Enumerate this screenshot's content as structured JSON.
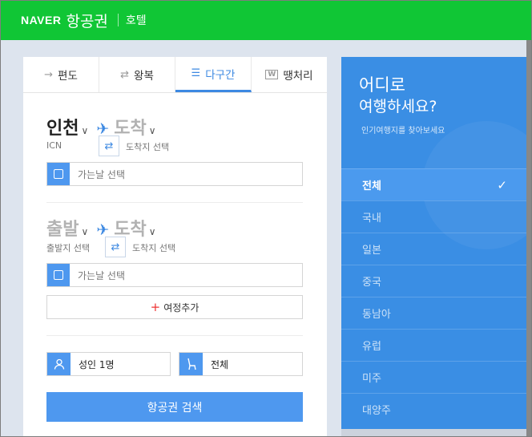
{
  "header": {
    "brand": "NAVER",
    "brand_sub": "항공권",
    "nav_hotel": "호텔"
  },
  "tabs": [
    {
      "label": "편도",
      "icon": "→"
    },
    {
      "label": "왕복",
      "icon": "⇄"
    },
    {
      "label": "다구간",
      "icon": "☰",
      "active": true
    },
    {
      "label": "땡처리",
      "icon": "W"
    }
  ],
  "segment1": {
    "origin": "인천",
    "origin_code": "ICN",
    "dest": "도착",
    "dest_hint": "도착지 선택",
    "date_placeholder": "가는날 선택"
  },
  "segment2": {
    "origin": "출발",
    "origin_hint": "출발지 선택",
    "dest": "도착",
    "dest_hint": "도착지 선택",
    "date_placeholder": "가는날 선택"
  },
  "add_trip": {
    "plus": "+",
    "label": "여정추가"
  },
  "passengers": "성인 1명",
  "seat_class": "전체",
  "search_button": "항공권 검색",
  "sidebar": {
    "title_line1": "어디로",
    "title_line2": "여행하세요?",
    "hint": "인기여행지를 찾아보세요",
    "regions": [
      "전체",
      "국내",
      "일본",
      "중국",
      "동남아",
      "유럽",
      "미주",
      "대양주"
    ],
    "active_check": "✓"
  },
  "colors": {
    "brand": "#10c635",
    "accent": "#3d89e2",
    "panel": "#3a8ee4"
  }
}
